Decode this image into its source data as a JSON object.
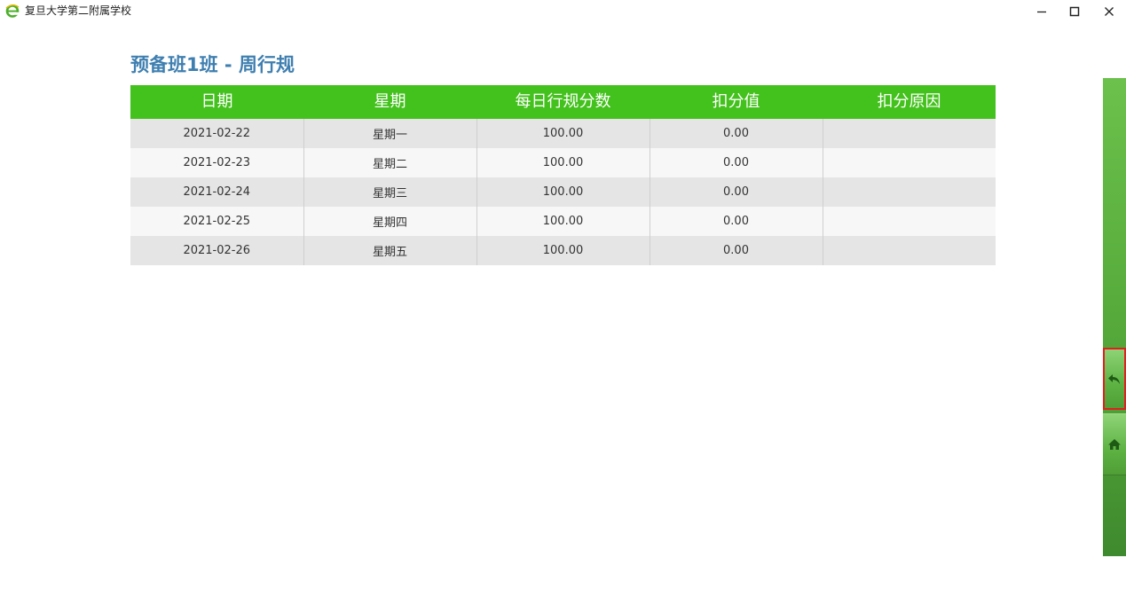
{
  "window": {
    "title": "复旦大学第二附属学校",
    "icon": "ie-browser-icon"
  },
  "page": {
    "title": "预备班1班 - 周行规"
  },
  "table": {
    "headers": [
      "日期",
      "星期",
      "每日行规分数",
      "扣分值",
      "扣分原因"
    ],
    "rows": [
      [
        "2021-02-22",
        "星期一",
        "100.00",
        "0.00",
        ""
      ],
      [
        "2021-02-23",
        "星期二",
        "100.00",
        "0.00",
        ""
      ],
      [
        "2021-02-24",
        "星期三",
        "100.00",
        "0.00",
        ""
      ],
      [
        "2021-02-25",
        "星期四",
        "100.00",
        "0.00",
        ""
      ],
      [
        "2021-02-26",
        "星期五",
        "100.00",
        "0.00",
        ""
      ]
    ]
  },
  "side_panel": {
    "buttons": [
      {
        "icon": "back-arrow-icon"
      },
      {
        "icon": "home-icon"
      }
    ]
  },
  "colors": {
    "header_green": "#43c11c",
    "title_blue": "#3f7fb0",
    "highlight_red": "#e02020"
  }
}
